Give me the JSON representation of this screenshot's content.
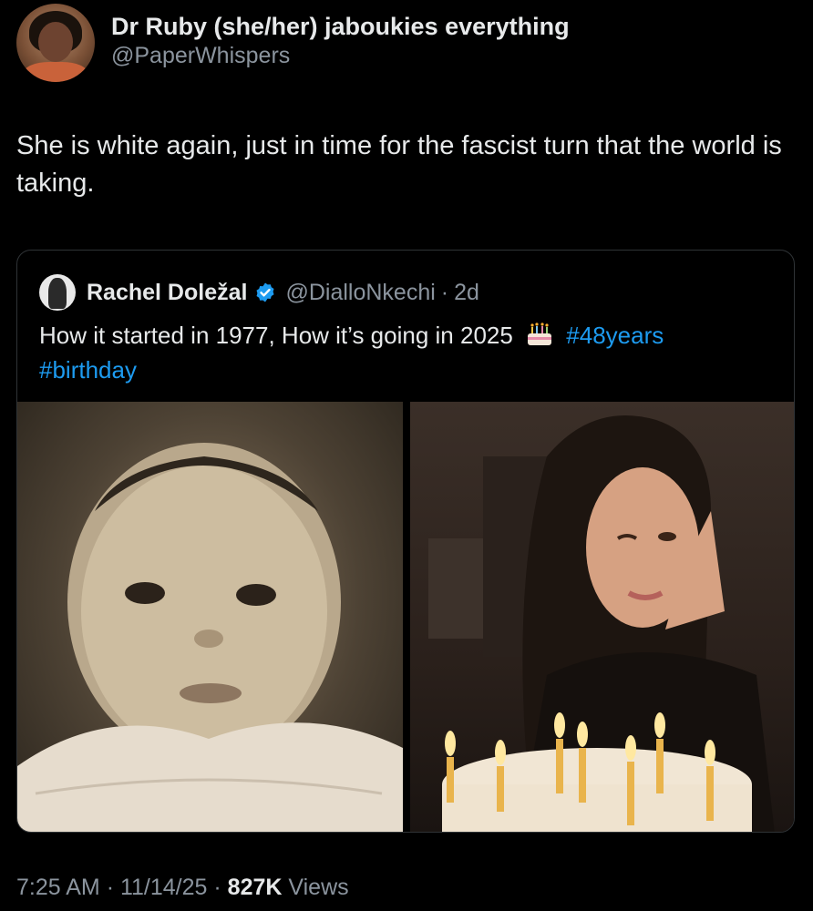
{
  "tweet": {
    "author": {
      "display_name": "Dr Ruby (she/her) jaboukies everything",
      "handle": "@PaperWhispers"
    },
    "text": "She is white again, just in time for the fascist turn that the world is taking.",
    "time": "7:25 AM",
    "date": "11/14/25",
    "views_count": "827K",
    "views_label": "Views",
    "separator": "·"
  },
  "quoted": {
    "display_name": "Rachel Doležal",
    "handle": "@DialloNkechi",
    "separator": "·",
    "age": "2d",
    "text_before": "How it started in 1977, How it’s going in 2025",
    "hashtags": [
      "#48years",
      "#birthday"
    ],
    "verified_icon": "verified-badge-icon",
    "emoji_icon": "birthday-cake-icon"
  },
  "colors": {
    "background": "#000000",
    "text": "#e7e9ea",
    "secondary": "#8b949e",
    "link": "#1d9bf0",
    "border": "#2f3336"
  }
}
